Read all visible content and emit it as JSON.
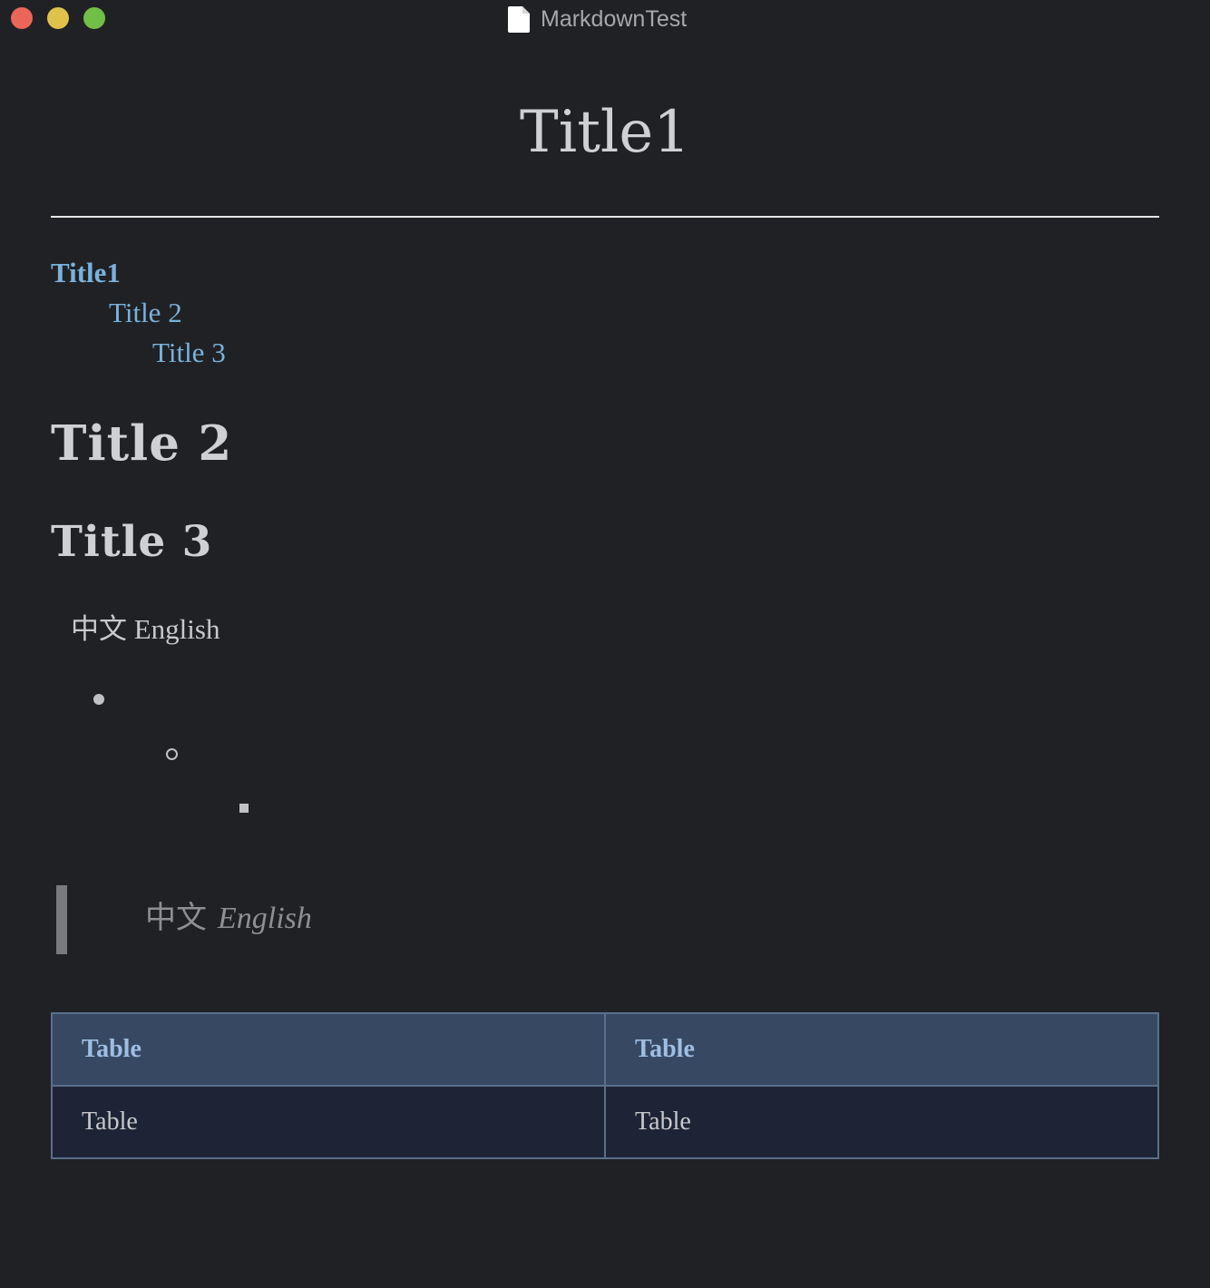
{
  "window": {
    "title": "MarkdownTest",
    "icon": "document-icon"
  },
  "document": {
    "h1": "Title1",
    "toc": [
      {
        "label": "Title1",
        "level": 1
      },
      {
        "label": "Title 2",
        "level": 2
      },
      {
        "label": "Title 3",
        "level": 3
      }
    ],
    "h2": "Title 2",
    "h3": "Title 3",
    "paragraph": "中文 English",
    "nested_list_markers": [
      "disc",
      "circle",
      "square"
    ],
    "blockquote": {
      "cjk": "中文",
      "emphasis": "English"
    },
    "table": {
      "headers": [
        "Table",
        "Table"
      ],
      "rows": [
        [
          "Table",
          "Table"
        ]
      ]
    }
  },
  "colors": {
    "background": "#202124",
    "link": "#79b2dc",
    "table_header_bg": "#374962",
    "table_body_bg": "#1d2436",
    "table_border": "#5a6f8c",
    "close": "#ec6559",
    "minimize": "#e0c14c",
    "zoom": "#71bf46"
  }
}
